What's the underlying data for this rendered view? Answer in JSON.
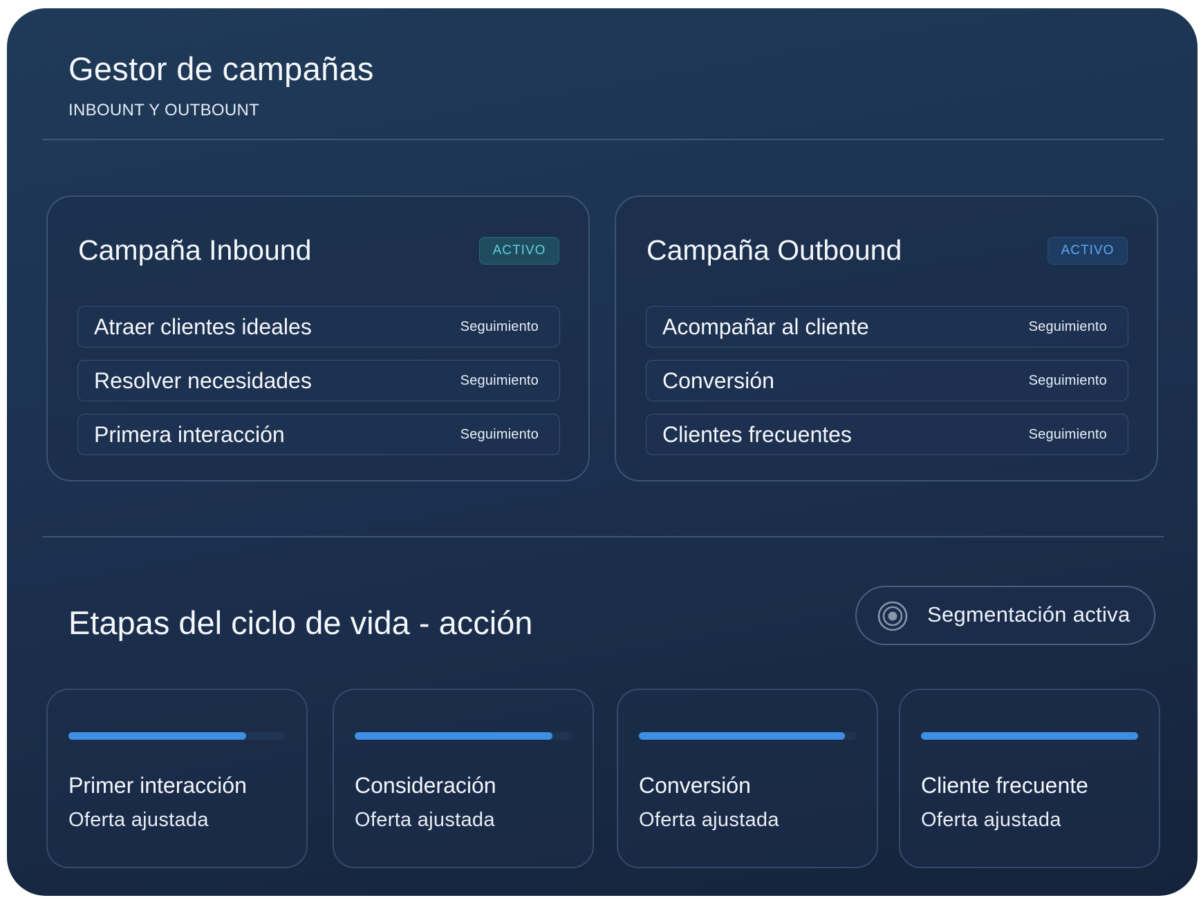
{
  "header": {
    "title": "Gestor de campañas",
    "subtitle": "INBOUNT Y OUTBOUNT"
  },
  "campaigns": [
    {
      "title": "Campaña Inbound",
      "status": "ACTIVO",
      "status_color": "#5fd0dc",
      "goals": [
        {
          "label": "Atraer clientes ideales",
          "tag": "Seguimiento"
        },
        {
          "label": "Resolver necesidades",
          "tag": "Seguimiento"
        },
        {
          "label": "Primera interacción",
          "tag": "Seguimiento"
        }
      ]
    },
    {
      "title": "Campaña Outbound",
      "status": "ACTIVO",
      "status_color": "#5da8f2",
      "goals": [
        {
          "label": "Acompañar al cliente",
          "tag": "Seguimiento"
        },
        {
          "label": "Conversión",
          "tag": "Seguimiento"
        },
        {
          "label": "Clientes frecuentes",
          "tag": "Seguimiento"
        }
      ]
    }
  ],
  "lifecycle": {
    "title": "Etapas del ciclo de vida - acción",
    "segment_label": "Segmentación activa",
    "segment_icon": "target-icon",
    "progress_color": "#3d8fe4",
    "stages": [
      {
        "name": "Primer interacción",
        "desc": "Oferta ajustada",
        "progress": 0.82
      },
      {
        "name": "Consideración",
        "desc": "Oferta ajustada",
        "progress": 0.91
      },
      {
        "name": "Conversión",
        "desc": "Oferta ajustada",
        "progress": 0.95
      },
      {
        "name": "Cliente frecuente",
        "desc": "Oferta ajustada",
        "progress": 1.0
      }
    ]
  }
}
